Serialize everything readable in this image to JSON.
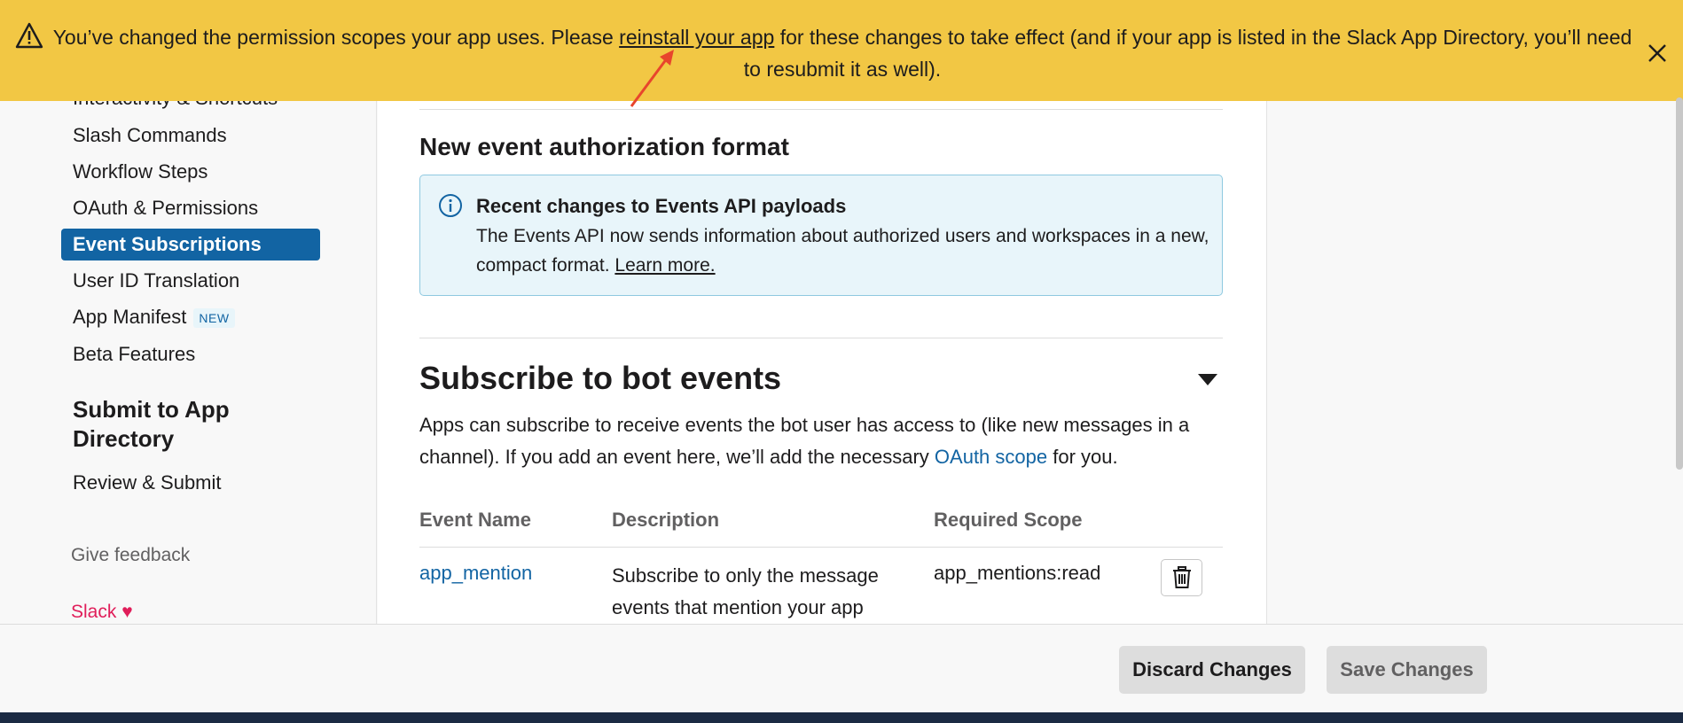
{
  "banner": {
    "text_before": "You’ve changed the permission scopes your app uses. Please ",
    "link": "reinstall your app",
    "text_after": " for these changes to take effect (and if your app is listed in the Slack App Directory, you’ll need to resubmit it as well).",
    "close_icon": "close-icon",
    "warning_icon": "warning-icon",
    "color": "#f2c744"
  },
  "sidebar": {
    "items": [
      {
        "label": "Interactivity & Shortcuts"
      },
      {
        "label": "Slash Commands"
      },
      {
        "label": "Workflow Steps"
      },
      {
        "label": "OAuth & Permissions"
      },
      {
        "label": "Event Subscriptions",
        "active": true
      },
      {
        "label": "User ID Translation"
      },
      {
        "label": "App Manifest",
        "badge": "NEW"
      },
      {
        "label": "Beta Features"
      }
    ],
    "section_title": "Submit to App Directory",
    "review": "Review & Submit",
    "feedback": "Give feedback",
    "slack_label": "Slack",
    "heart": "♥",
    "active_color": "#1264a3"
  },
  "main": {
    "auth_title": "New event authorization format",
    "info": {
      "title": "Recent changes to Events API payloads",
      "body": "The Events API now sends information about authorized users and workspaces in a new, compact format. ",
      "link": "Learn more."
    },
    "bot_events_title": "Subscribe to bot events",
    "bot_desc_before": "Apps can subscribe to receive events the bot user has access to (like new messages in a channel). If you add an event here, we’ll add the necessary ",
    "bot_desc_link": "OAuth scope",
    "bot_desc_after": " for you.",
    "table": {
      "headers": [
        "Event Name",
        "Description",
        "Required Scope"
      ],
      "rows": [
        {
          "name": "app_mention",
          "description": "Subscribe to only the message events that mention your app",
          "scope": "app_mentions:read"
        }
      ]
    }
  },
  "footer": {
    "discard": "Discard Changes",
    "save": "Save Changes"
  }
}
